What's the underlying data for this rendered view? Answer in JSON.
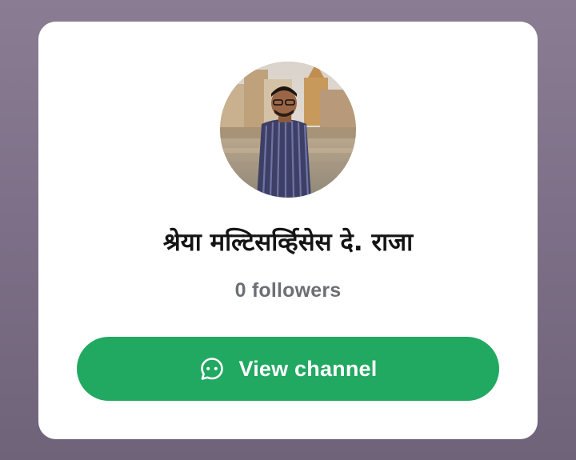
{
  "channel": {
    "name": "श्रेया मल्टिसर्व्हिसेस दे. राजा",
    "followers": "0 followers"
  },
  "actions": {
    "view_channel_label": "View channel",
    "view_channel_icon": "channel-icon"
  },
  "colors": {
    "accent": "#21a861",
    "background": "#7d7088",
    "card": "#ffffff",
    "name_text": "#141414",
    "followers_text": "#6b7075"
  }
}
